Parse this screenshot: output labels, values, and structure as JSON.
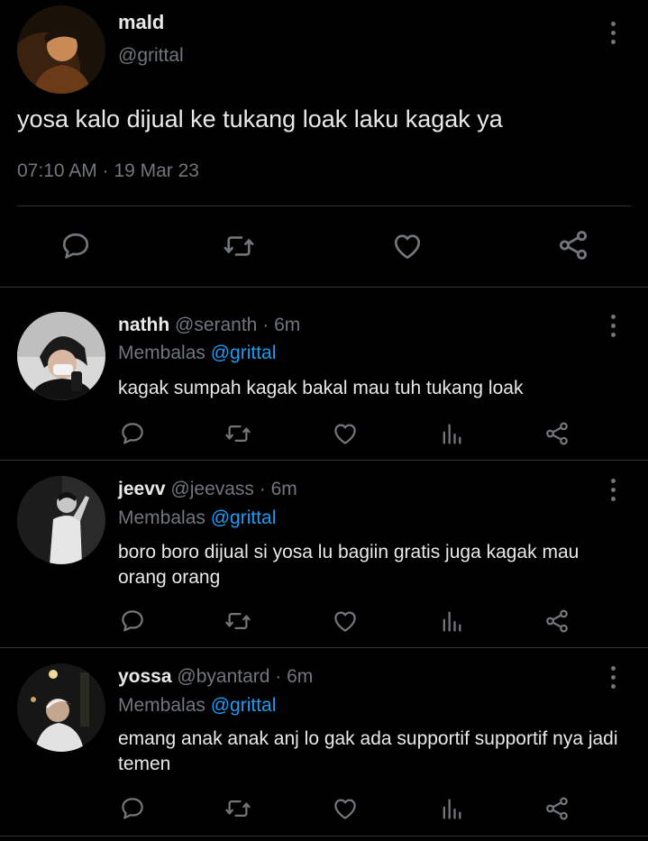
{
  "main_tweet": {
    "name": "mald",
    "handle": "@grittal",
    "text": "yosa kalo dijual ke tukang loak laku kagak ya",
    "timestamp": "07:10 AM · 19 Mar 23"
  },
  "replies": [
    {
      "name": "nathh",
      "handle": "@seranth",
      "separator": "·",
      "time": "6m",
      "replying_prefix": "Membalas",
      "replying_to": "@grittal",
      "text": "kagak sumpah kagak bakal mau tuh tukang loak"
    },
    {
      "name": "jeevv",
      "handle": "@jeevass",
      "separator": "·",
      "time": "6m",
      "replying_prefix": "Membalas",
      "replying_to": "@grittal",
      "text": "boro boro dijual si yosa lu bagiin gratis juga kagak mau orang orang"
    },
    {
      "name": "yossa",
      "handle": "@byantard",
      "separator": "·",
      "time": "6m",
      "replying_prefix": "Membalas",
      "replying_to": "@grittal",
      "text": "emang anak anak anj lo gak ada supportif supportif nya jadi temen"
    }
  ],
  "colors": {
    "background": "#000000",
    "primary_text": "#e7e9ea",
    "secondary_text": "#71767b",
    "mention": "#1d9bf0",
    "divider": "#2f3336"
  },
  "icons": {
    "main_actions": [
      "reply-icon",
      "retweet-icon",
      "like-icon",
      "share-icon"
    ],
    "reply_actions": [
      "reply-icon",
      "retweet-icon",
      "like-icon",
      "analytics-icon",
      "share-icon"
    ],
    "menu": "more-options-icon"
  }
}
